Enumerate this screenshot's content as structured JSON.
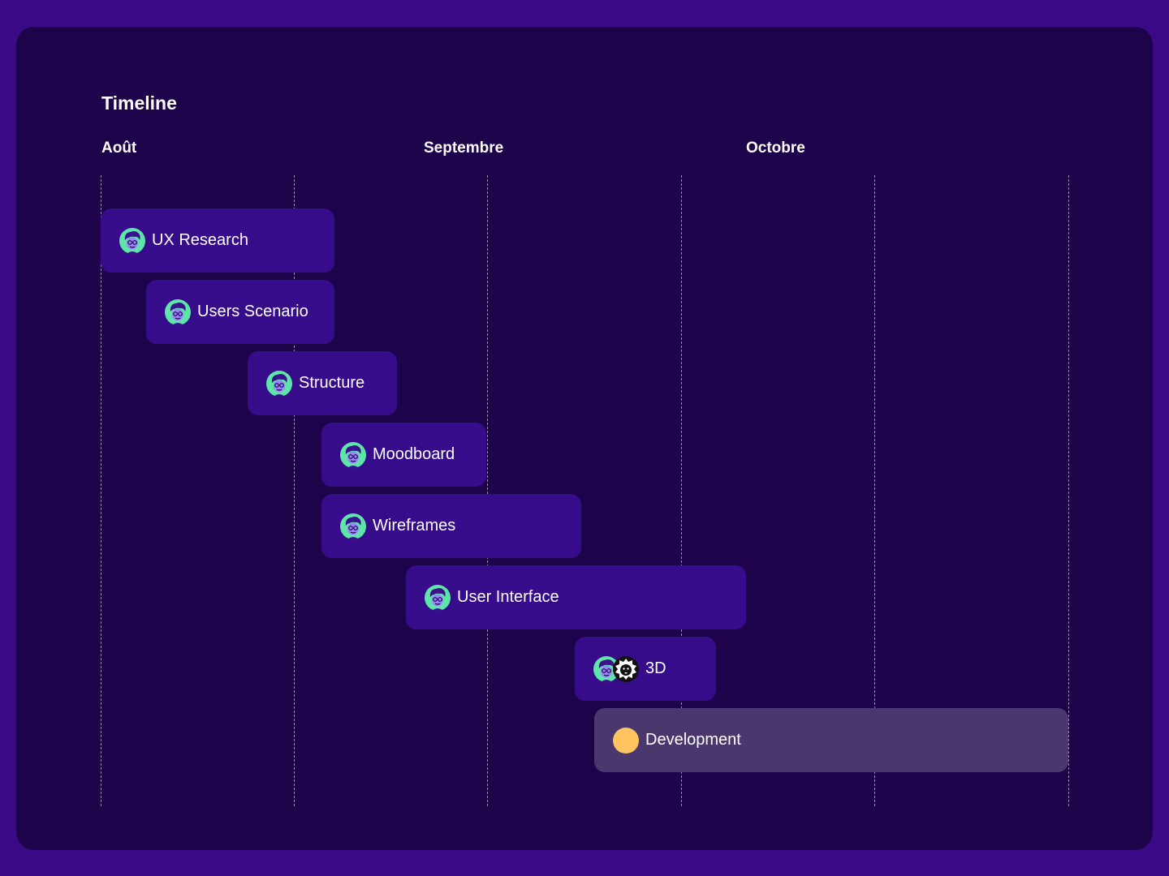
{
  "timeline": {
    "title": "Timeline",
    "months": [
      "Août",
      "Septembre",
      "Octobre"
    ],
    "tasks": [
      {
        "label": "UX Research",
        "avatars": [
          "designer-avatar-icon"
        ]
      },
      {
        "label": "Users Scenario",
        "avatars": [
          "designer-avatar-icon"
        ]
      },
      {
        "label": "Structure",
        "avatars": [
          "designer-avatar-icon"
        ]
      },
      {
        "label": "Moodboard",
        "avatars": [
          "designer-avatar-icon"
        ]
      },
      {
        "label": "Wireframes",
        "avatars": [
          "designer-avatar-icon"
        ]
      },
      {
        "label": "User Interface",
        "avatars": [
          "designer-avatar-icon"
        ]
      },
      {
        "label": "3D",
        "avatars": [
          "designer-avatar-icon",
          "lion-avatar-icon"
        ]
      },
      {
        "label": "Development",
        "avatars": [
          "yellow-dot-avatar-icon"
        ]
      }
    ]
  },
  "colors": {
    "page_background": "#3a0a86",
    "card_background": "#1c034a",
    "task_bar": "#360c8a",
    "task_bar_development": "#4a376e",
    "avatar_green": "#5ee6a8",
    "avatar_yellow": "#ffc45e"
  }
}
